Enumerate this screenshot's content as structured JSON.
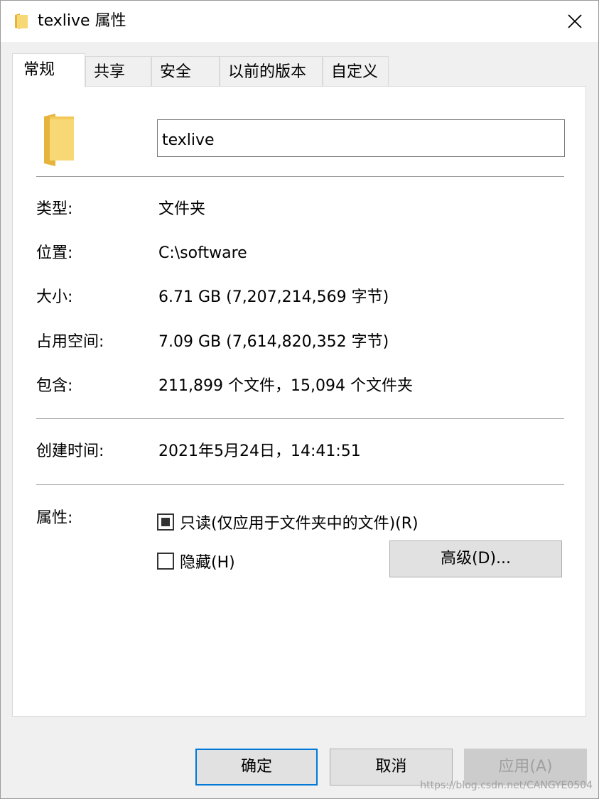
{
  "window": {
    "title": "texlive 属性"
  },
  "icons": {
    "title": "folder-icon",
    "close": "close-icon",
    "folder_large": "folder-icon"
  },
  "tabs": [
    {
      "label": "常规",
      "active": true
    },
    {
      "label": "共享",
      "active": false
    },
    {
      "label": "安全",
      "active": false
    },
    {
      "label": "以前的版本",
      "active": false
    },
    {
      "label": "自定义",
      "active": false
    }
  ],
  "general": {
    "name_value": "texlive",
    "type_label": "类型:",
    "type_value": "文件夹",
    "location_label": "位置:",
    "location_value": "C:\\software",
    "size_label": "大小:",
    "size_value": "6.71 GB (7,207,214,569 字节)",
    "size_on_disk_label": "占用空间:",
    "size_on_disk_value": "7.09 GB (7,614,820,352 字节)",
    "contains_label": "包含:",
    "contains_value": "211,899 个文件，15,094 个文件夹",
    "created_label": "创建时间:",
    "created_value": "2021年5月24日，14:41:51",
    "attributes_label": "属性:",
    "readonly_label": "只读(仅应用于文件夹中的文件)(R)",
    "readonly_state": "indeterminate",
    "hidden_label": "隐藏(H)",
    "hidden_checked": false,
    "advanced_button": "高级(D)..."
  },
  "buttons": {
    "ok": "确定",
    "cancel": "取消",
    "apply": "应用(A)"
  },
  "colors": {
    "folder_yellow": "#f8d775",
    "folder_dark": "#e6b43c",
    "accent_border": "#0078d7"
  },
  "watermark": "https://blog.csdn.net/CANGYE0504"
}
